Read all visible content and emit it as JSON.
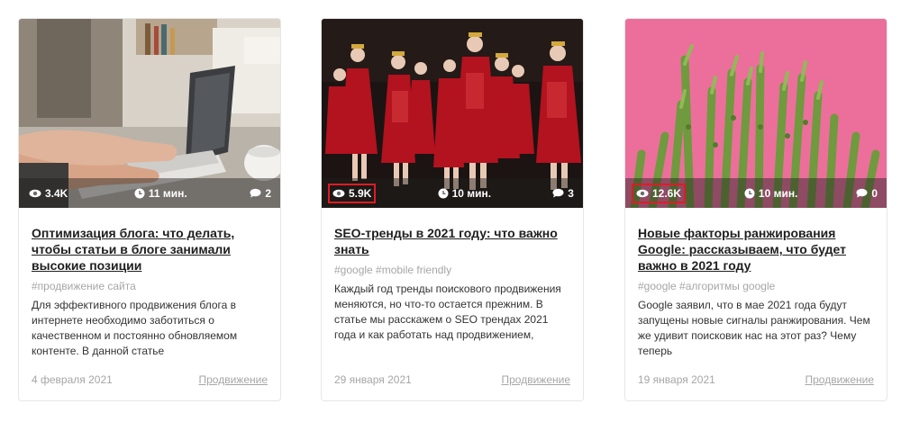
{
  "cards": [
    {
      "views": "3.4K",
      "read_time": "11 мин.",
      "comments": "2",
      "title": "Оптимизация блога: что делать, чтобы статьи в блоге занимали высокие позиции",
      "tags": "#продвижение сайта",
      "excerpt": "Для эффективного продвижения блога в интернете необходимо заботиться о качественном и постоянно обновляемом контенте. В данной статье",
      "date": "4 февраля 2021",
      "category": "Продвижение",
      "image": "laptop-desk-photo",
      "views_highlighted": false
    },
    {
      "views": "5.9K",
      "read_time": "10 мин.",
      "comments": "3",
      "title": "SEO-тренды в 2021 году: что важно знать",
      "tags": "#google #mobile friendly",
      "excerpt": "Каждый год тренды поискового продвижения меняются, но что-то остается прежним. В статье мы расскажем о SEO трендах 2021 года и как работать над продвижением,",
      "date": "29 января 2021",
      "category": "Продвижение",
      "image": "fashion-runway-photo",
      "views_highlighted": true
    },
    {
      "views": "12.6K",
      "read_time": "10 мин.",
      "comments": "0",
      "title": "Новые факторы ранжирования Google: рассказываем, что будет важно в 2021 году",
      "tags": "#google #алгоритмы google",
      "excerpt": "Google заявил, что в мае 2021 года будут запущены новые сигналы ранжирования. Чем же удивит поисковик нас на этот раз? Чему теперь",
      "date": "19 января 2021",
      "category": "Продвижение",
      "image": "asparagus-pink-photo",
      "views_highlighted": true
    }
  ],
  "colors": {
    "highlight": "#e01b24",
    "muted": "#a6a6a6",
    "title": "#1f1f1f",
    "pink_bg": "#ec6f9b"
  }
}
